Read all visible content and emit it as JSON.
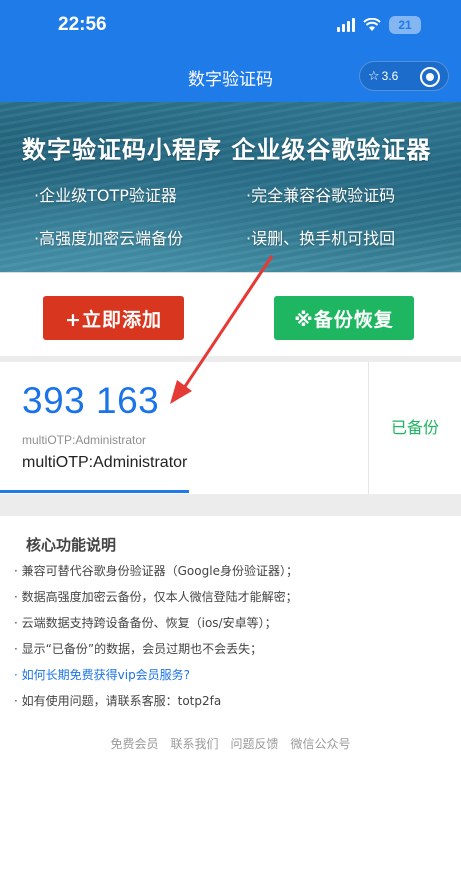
{
  "status_bar": {
    "time": "22:56",
    "battery": "21"
  },
  "nav": {
    "title": "数字验证码",
    "capsule_version": "3.6"
  },
  "banner": {
    "title": "数字验证码小程序  企业级谷歌验证器",
    "features": [
      "·企业级TOTP验证器",
      "·完全兼容谷歌验证码",
      "·高强度加密云端备份",
      "·误删、换手机可找回"
    ]
  },
  "buttons": {
    "add": "+立即添加",
    "restore": "※备份恢复"
  },
  "otp_card": {
    "code": "393 163",
    "issuer_small": "multiOTP:Administrator",
    "account": "multiOTP:Administrator",
    "backup_status": "已备份",
    "progress_fraction": 0.41
  },
  "info": {
    "title": "核心功能说明",
    "items": [
      "· 兼容可替代谷歌身份验证器（Google身份验证器）；",
      "· 数据高强度加密云备份，仅本人微信登陆才能解密；",
      "· 云端数据支持跨设备备份、恢复（ios/安卓等）；",
      "· 显示“已备份”的数据，会员过期也不会丢失；",
      "· 如何长期免费获得vip会员服务?",
      "· 如有使用问题，请联系客服：totp2fa"
    ],
    "link_color": "#1a73e8"
  },
  "footer": {
    "links": [
      "免费会员",
      "联系我们",
      "问题反馈",
      "微信公众号"
    ]
  },
  "colors": {
    "primary": "#1f7be8",
    "add_button": "#d9361f",
    "restore_button": "#1fb661",
    "annotation_arrow": "#e53935"
  },
  "icons": {
    "signal": "signal-icon",
    "wifi": "wifi-icon",
    "battery": "battery-icon",
    "star": "star-icon",
    "record": "record-icon"
  }
}
